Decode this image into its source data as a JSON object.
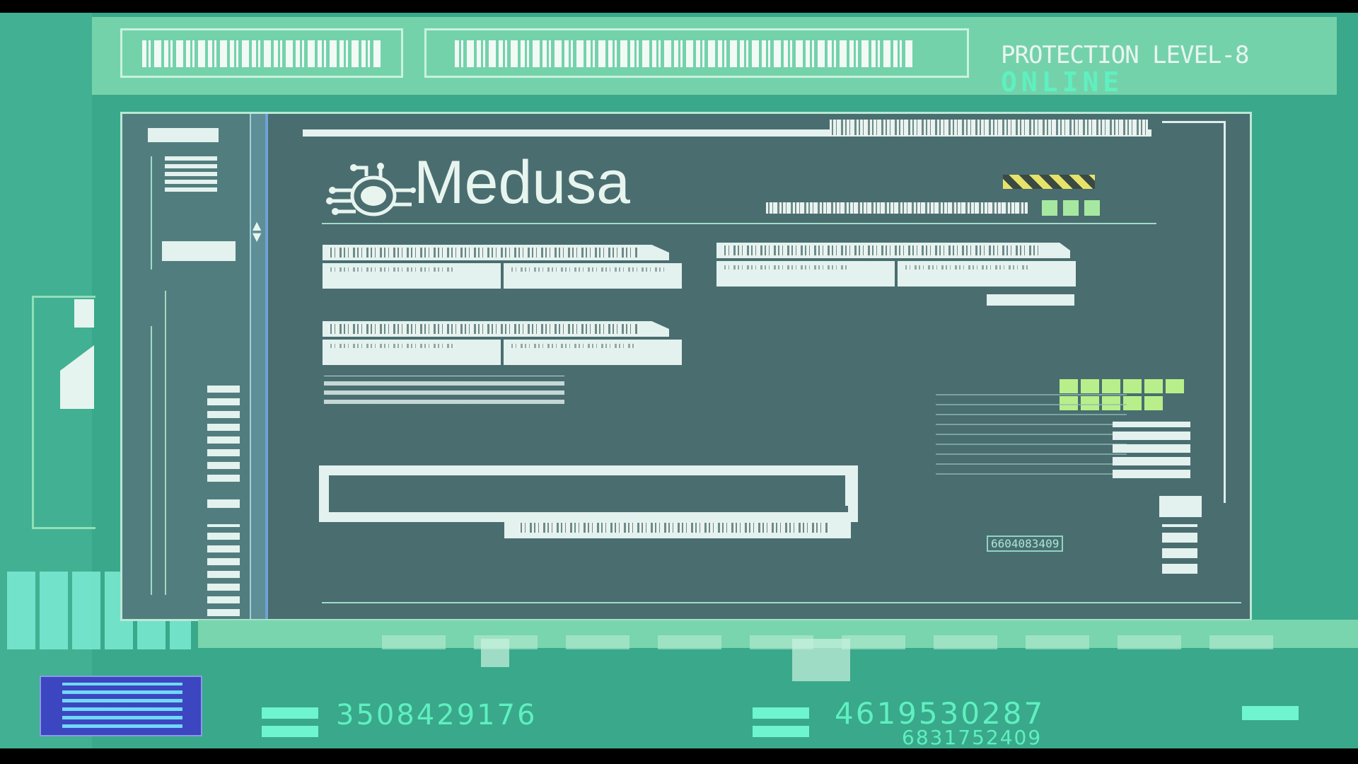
{
  "status": {
    "protection": "PROTECTION LEVEL-8",
    "state": "ONLINE"
  },
  "app": {
    "logo_text": "Medusa"
  },
  "readouts": {
    "left_number": "3508429176",
    "right_number": "4619530287",
    "right_sub_number": "6831752409",
    "panel_code": "6604083409"
  },
  "colors": {
    "background": "#3aa88a",
    "panel": "#4a6d70",
    "accent": "#5ff0c0",
    "text": "#e8f5ef",
    "indicator_green": "#b9ef8a",
    "warning_yellow": "#e7e36a"
  },
  "icons": {
    "logo": "circuit-brain-icon",
    "scroll": "scroll-arrows-icon",
    "hazard": "hazard-stripe-icon"
  }
}
